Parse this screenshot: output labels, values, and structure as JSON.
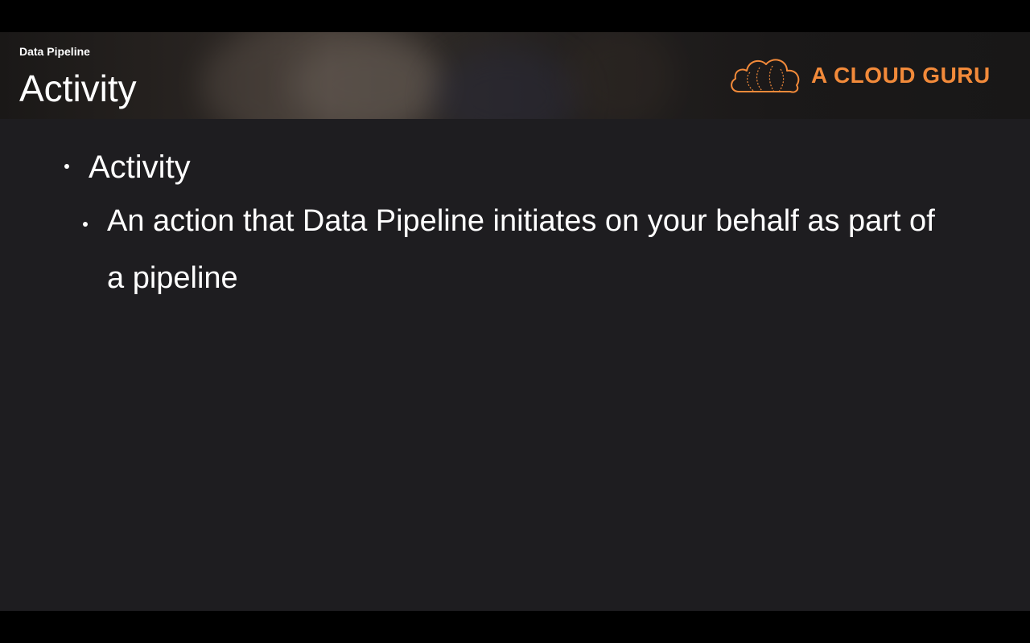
{
  "header": {
    "section": "Data Pipeline",
    "title": "Activity",
    "logo": {
      "text": "A CLOUD GURU",
      "icon": "cloud-logo-icon",
      "color": "#f28a3a"
    }
  },
  "bullets": {
    "level1": "Activity",
    "level2": "An action that Data Pipeline initiates on your behalf as part of a pipeline"
  }
}
